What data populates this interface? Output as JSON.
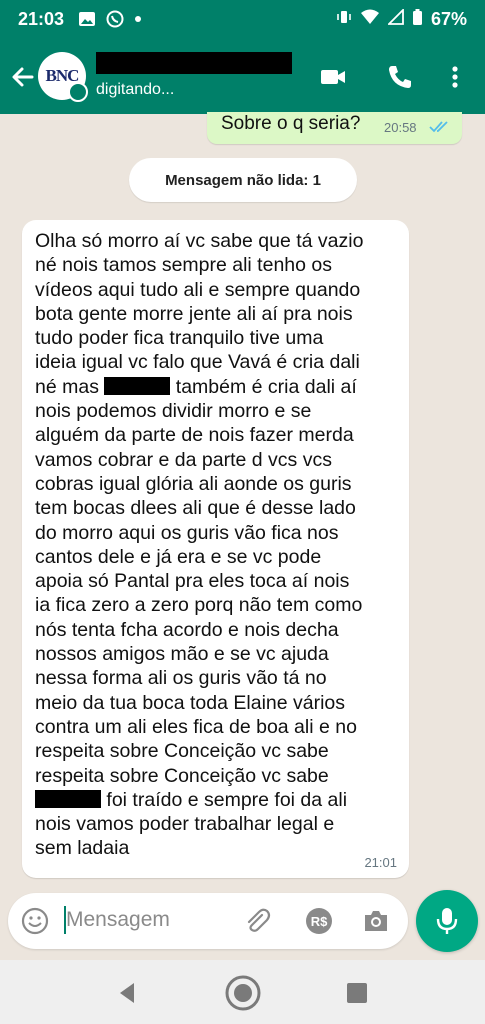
{
  "status_bar": {
    "time": "21:03",
    "battery": "67%",
    "icons": [
      "image-icon",
      "whatsapp-icon",
      "dot-icon",
      "vibrate-icon",
      "wifi-icon",
      "signal-icon",
      "battery-icon"
    ]
  },
  "header": {
    "avatar_text": "BNC",
    "status": "digitando...",
    "icons": [
      "back-arrow-icon",
      "video-call-icon",
      "phone-icon",
      "more-vert-icon"
    ]
  },
  "messages": {
    "sent": {
      "text": "Sobre o q seria?",
      "time": "20:58"
    },
    "unread_banner": "Mensagem não lida: 1",
    "received": {
      "lines": [
        "Olha só morro aí vc sabe que tá vazio",
        "né nois tamos sempre ali  tenho os",
        "vídeos aqui tudo ali e sempre quando",
        "bota gente morre jente ali  aí pra nois",
        "tudo poder fica tranquilo  tive uma",
        "ideia igual vc falo que Vavá é cria dali",
        "né mas",
        "também é cria dali aí",
        "nois podemos dividir morro e se",
        "alguém da parte de nois  fazer merda",
        "vamos cobrar e da parte d vcs vcs",
        "cobras igual glória ali aonde os guris",
        "tem bocas dlees ali que é desse lado",
        "do morro aqui  os guris vão fica nos",
        "cantos dele e já era e se vc pode",
        "apoia só Pantal pra eles toca aí nois",
        "ia fica zero a zero porq não tem como",
        "nós tenta fcha acordo e nois decha",
        "nossos amigos mão  e se vc ajuda",
        "nessa forma ali os guris vão tá no",
        "meio da tua boca toda Elaine vários",
        "contra um ali eles fica de boa ali e no",
        "respeita  sobre Conceição vc sabe",
        "foi traído e sempre foi da ali",
        "nois vamos poder trabalhar legal e",
        "sem ladaia"
      ],
      "time": "21:01"
    }
  },
  "input": {
    "placeholder": "Mensagem",
    "icons": [
      "emoji-icon",
      "attach-icon",
      "payment-icon",
      "camera-icon",
      "mic-icon"
    ]
  },
  "nav": {
    "icons": [
      "back-triangle-icon",
      "home-circle-icon",
      "recents-square-icon"
    ]
  },
  "colors": {
    "header": "#008069",
    "sent_bubble": "#dcf8c6",
    "mic_button": "#00a884",
    "read_ticks": "#53bdeb"
  }
}
